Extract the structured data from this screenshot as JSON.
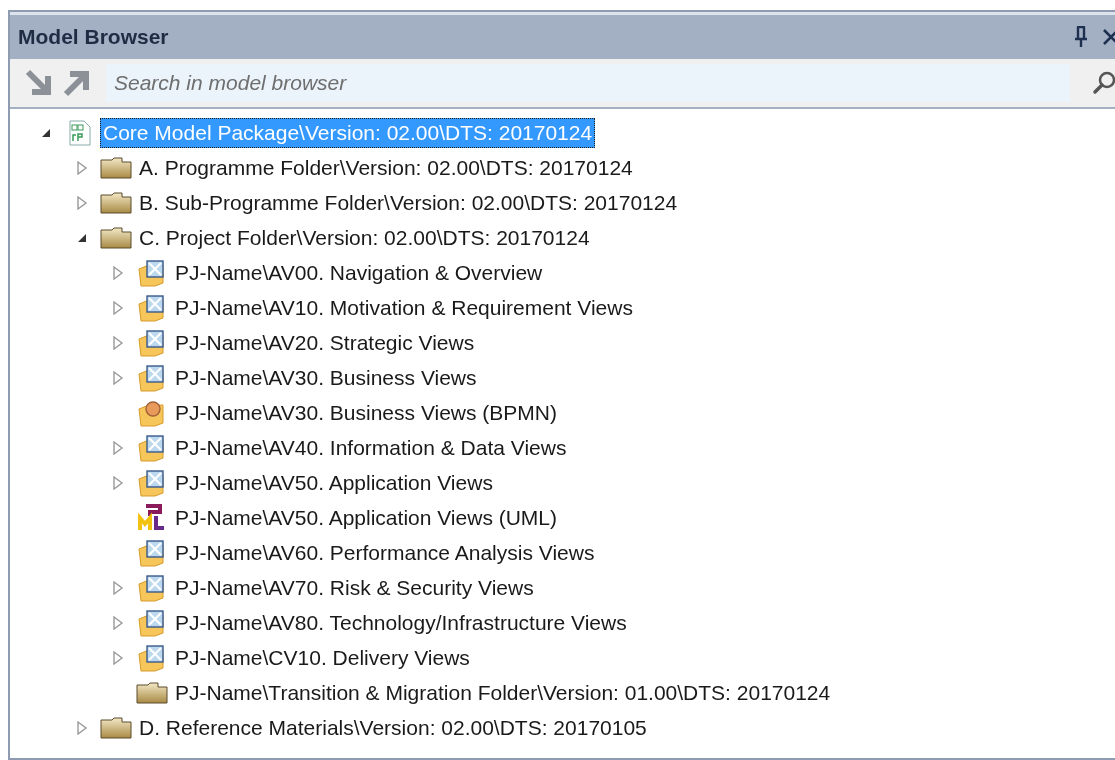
{
  "panel": {
    "title": "Model Browser"
  },
  "search": {
    "placeholder": "Search in model browser"
  },
  "tree": [
    {
      "label": "Core Model Package\\Version: 02.00\\DTS: 20170124",
      "kind": "package",
      "selected": true,
      "expanded": true,
      "children": [
        {
          "label": "A. Programme Folder\\Version: 02.00\\DTS: 20170124",
          "kind": "folder",
          "selected": false,
          "expanded": false
        },
        {
          "label": "B. Sub-Programme Folder\\Version: 02.00\\DTS: 20170124",
          "kind": "folder",
          "selected": false,
          "expanded": false
        },
        {
          "label": "C. Project Folder\\Version: 02.00\\DTS: 20170124",
          "kind": "folder",
          "selected": false,
          "expanded": true,
          "children": [
            {
              "label": "PJ-Name\\AV00. Navigation & Overview",
              "kind": "view",
              "selected": false,
              "expanded": false
            },
            {
              "label": "PJ-Name\\AV10. Motivation & Requirement Views",
              "kind": "view",
              "selected": false,
              "expanded": false
            },
            {
              "label": "PJ-Name\\AV20. Strategic Views",
              "kind": "view",
              "selected": false,
              "expanded": false
            },
            {
              "label": "PJ-Name\\AV30. Business Views",
              "kind": "view",
              "selected": false,
              "expanded": false
            },
            {
              "label": "PJ-Name\\AV30. Business Views (BPMN)",
              "kind": "bpmn",
              "selected": false
            },
            {
              "label": "PJ-Name\\AV40. Information & Data Views",
              "kind": "view",
              "selected": false,
              "expanded": false
            },
            {
              "label": "PJ-Name\\AV50. Application Views",
              "kind": "view",
              "selected": false,
              "expanded": false
            },
            {
              "label": "PJ-Name\\AV50. Application Views (UML)",
              "kind": "uml",
              "selected": false
            },
            {
              "label": "PJ-Name\\AV60. Performance Analysis Views",
              "kind": "view",
              "selected": false
            },
            {
              "label": "PJ-Name\\AV70. Risk & Security Views",
              "kind": "view",
              "selected": false,
              "expanded": false
            },
            {
              "label": "PJ-Name\\AV80. Technology/Infrastructure Views",
              "kind": "view",
              "selected": false,
              "expanded": false
            },
            {
              "label": "PJ-Name\\CV10. Delivery Views",
              "kind": "view",
              "selected": false,
              "expanded": false
            },
            {
              "label": "PJ-Name\\Transition & Migration Folder\\Version: 01.00\\DTS: 20170124",
              "kind": "folder",
              "selected": false
            }
          ]
        },
        {
          "label": "D. Reference Materials\\Version: 02.00\\DTS: 20170105",
          "kind": "folder",
          "selected": false,
          "expanded": false
        }
      ]
    }
  ]
}
